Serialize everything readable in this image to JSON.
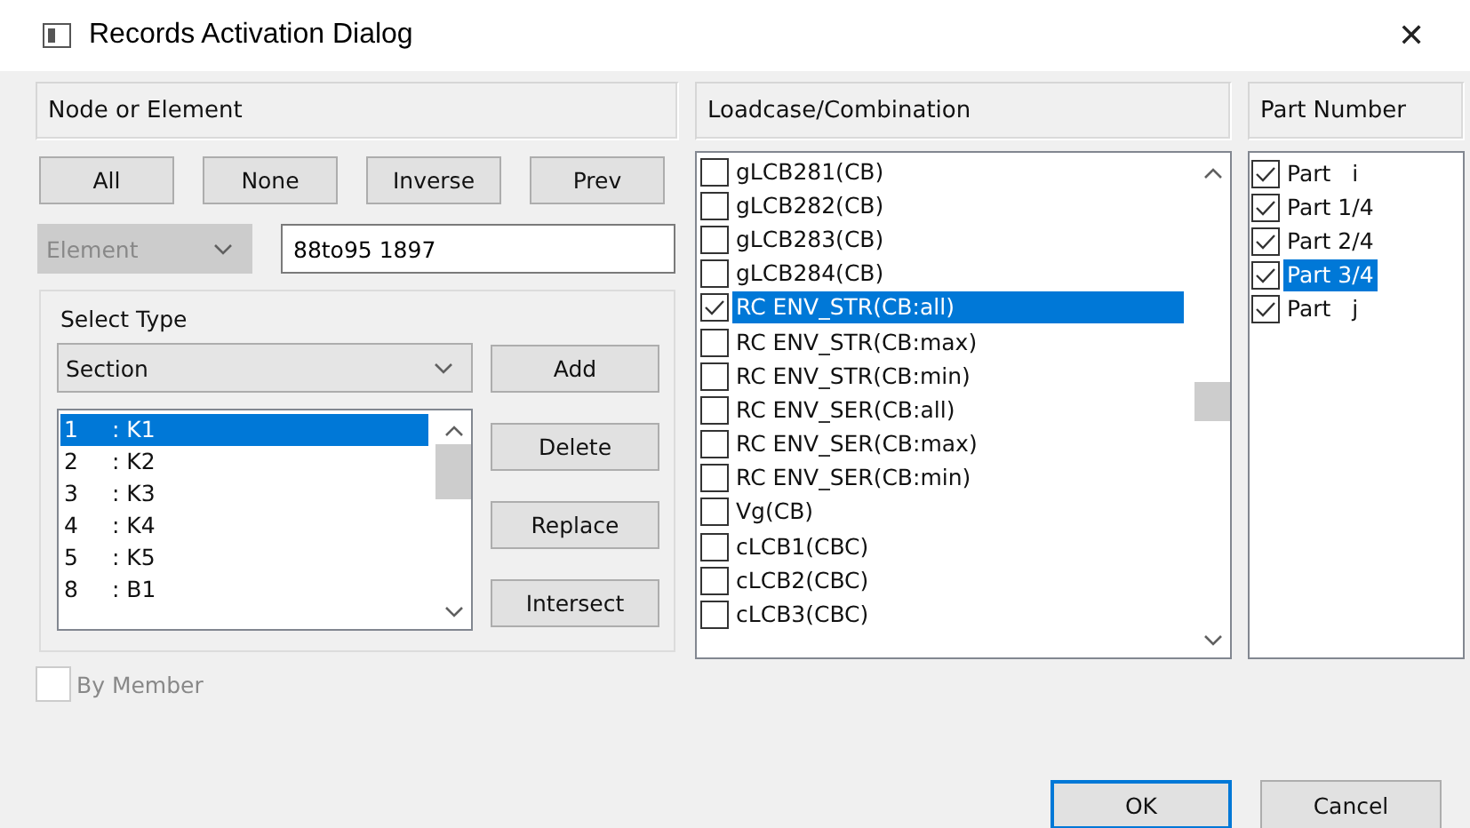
{
  "window": {
    "title": "Records Activation Dialog",
    "close": "✕"
  },
  "node_panel": {
    "header": "Node or Element",
    "buttons": [
      "All",
      "None",
      "Inverse",
      "Prev"
    ],
    "mode_dropdown": {
      "value": "Element",
      "disabled": true
    },
    "selection_field": {
      "value": "88to95 1897"
    },
    "select_type": {
      "label": "Select Type",
      "dropdown": {
        "value": "Section"
      },
      "items": [
        {
          "number": "1",
          "name": ": K1",
          "selected": true
        },
        {
          "number": "2",
          "name": ": K2",
          "selected": false
        },
        {
          "number": "3",
          "name": ": K3",
          "selected": false
        },
        {
          "number": "4",
          "name": ": K4",
          "selected": false
        },
        {
          "number": "5",
          "name": ": K5",
          "selected": false
        },
        {
          "number": "8",
          "name": ": B1",
          "selected": false
        }
      ],
      "buttons": [
        "Add",
        "Delete",
        "Replace",
        "Intersect"
      ]
    },
    "by_member": {
      "label": "By Member",
      "checked": false,
      "disabled": true
    }
  },
  "loadcase_panel": {
    "header": "Loadcase/Combination",
    "items": [
      {
        "label": "gLCB281(CB)",
        "checked": false,
        "selected": false
      },
      {
        "label": "gLCB282(CB)",
        "checked": false,
        "selected": false
      },
      {
        "label": "gLCB283(CB)",
        "checked": false,
        "selected": false
      },
      {
        "label": "gLCB284(CB)",
        "checked": false,
        "selected": false
      },
      {
        "label": "RC ENV_STR(CB:all)",
        "checked": true,
        "selected": true
      },
      {
        "label": "RC ENV_STR(CB:max)",
        "checked": false,
        "selected": false
      },
      {
        "label": "RC ENV_STR(CB:min)",
        "checked": false,
        "selected": false
      },
      {
        "label": "RC ENV_SER(CB:all)",
        "checked": false,
        "selected": false
      },
      {
        "label": "RC ENV_SER(CB:max)",
        "checked": false,
        "selected": false
      },
      {
        "label": "RC ENV_SER(CB:min)",
        "checked": false,
        "selected": false
      },
      {
        "label": "Vg(CB)",
        "checked": false,
        "selected": false
      },
      {
        "label": "cLCB1(CBC)",
        "checked": false,
        "selected": false
      },
      {
        "label": "cLCB2(CBC)",
        "checked": false,
        "selected": false
      },
      {
        "label": "cLCB3(CBC)",
        "checked": false,
        "selected": false
      }
    ]
  },
  "part_panel": {
    "header": "Part Number",
    "items": [
      {
        "label": "Part   i",
        "checked": true,
        "selected": false
      },
      {
        "label": "Part 1/4",
        "checked": true,
        "selected": false
      },
      {
        "label": "Part 2/4",
        "checked": true,
        "selected": false
      },
      {
        "label": "Part 3/4",
        "checked": true,
        "selected": true
      },
      {
        "label": "Part   j",
        "checked": true,
        "selected": false
      }
    ]
  },
  "footer_buttons": [
    {
      "label": "OK",
      "default": true
    },
    {
      "label": "Cancel",
      "default": false
    }
  ]
}
